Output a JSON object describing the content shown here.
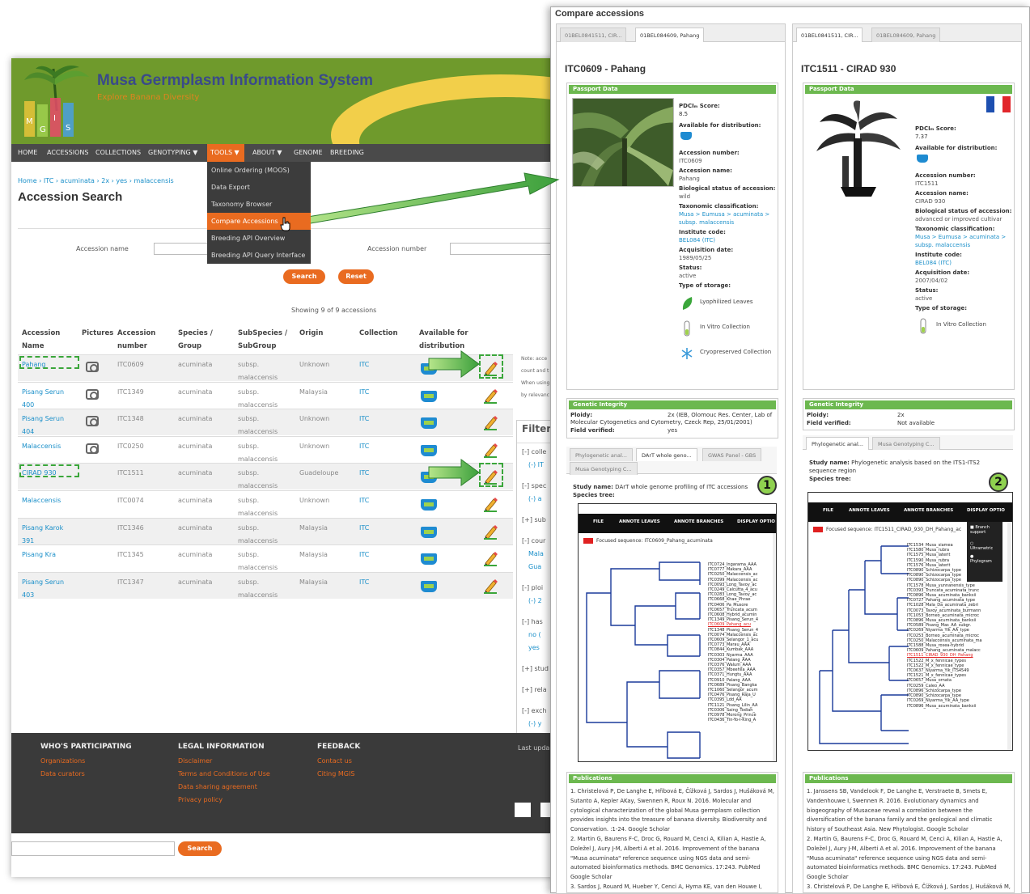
{
  "site": {
    "title": "Musa Germplasm Information System",
    "subtitle": "Explore Banana Diversity",
    "logo_letters": "MGIS"
  },
  "nav": {
    "items": [
      "HOME",
      "ACCESSIONS",
      "COLLECTIONS",
      "GENOTYPING ▼",
      "TOOLS ▼",
      "ABOUT ▼",
      "GENOME",
      "BREEDING"
    ],
    "active": "TOOLS ▼"
  },
  "tools_menu": {
    "items": [
      "Online Ordering (MOOS)",
      "Data Export",
      "Taxonomy Browser",
      "Compare Accessions",
      "Breeding API Overview",
      "Breeding API Query Interface"
    ],
    "highlighted": "Compare Accessions"
  },
  "breadcrumb": "Home › ITC › acuminata › 2x › yes › malaccensis",
  "page_title": "Accession Search",
  "search": {
    "accession_name_label": "Accession name",
    "accession_number_label": "Accession number",
    "search_button": "Search",
    "reset_button": "Reset"
  },
  "results": {
    "showing": "Showing 9 of 9 accessions",
    "headers": {
      "name": [
        "Accession",
        "Name"
      ],
      "pictures": "Pictures",
      "number": [
        "Accession",
        "number"
      ],
      "species": [
        "Species /",
        "Group"
      ],
      "subspecies": [
        "SubSpecies /",
        "SubGroup"
      ],
      "origin": "Origin",
      "collection": "Collection",
      "available": [
        "Available for",
        "distribution"
      ]
    },
    "rows": [
      {
        "name": [
          "Pahang"
        ],
        "pic": true,
        "number": "ITC0609",
        "species": "acuminata",
        "sub": [
          "subsp.",
          "malaccensis"
        ],
        "origin": "Unknown",
        "collection": "ITC"
      },
      {
        "name": [
          "Pisang Serun",
          "400"
        ],
        "pic": true,
        "number": "ITC1349",
        "species": "acuminata",
        "sub": [
          "subsp.",
          "malaccensis"
        ],
        "origin": "Malaysia",
        "collection": "ITC"
      },
      {
        "name": [
          "Pisang Serun",
          "404"
        ],
        "pic": true,
        "number": "ITC1348",
        "species": "acuminata",
        "sub": [
          "subsp.",
          "malaccensis"
        ],
        "origin": "Unknown",
        "collection": "ITC"
      },
      {
        "name": [
          "Malaccensis"
        ],
        "pic": true,
        "number": "ITC0250",
        "species": "acuminata",
        "sub": [
          "subsp.",
          "malaccensis"
        ],
        "origin": "Unknown",
        "collection": "ITC"
      },
      {
        "name": [
          "CIRAD 930"
        ],
        "pic": false,
        "number": "ITC1511",
        "species": "acuminata",
        "sub": [
          "subsp.",
          "malaccensis"
        ],
        "origin": "Guadeloupe",
        "collection": "ITC"
      },
      {
        "name": [
          "Malaccensis"
        ],
        "pic": false,
        "number": "ITC0074",
        "species": "acuminata",
        "sub": [
          "subsp.",
          "malaccensis"
        ],
        "origin": "Unknown",
        "collection": "ITC"
      },
      {
        "name": [
          "Pisang Karok",
          "391"
        ],
        "pic": false,
        "number": "ITC1346",
        "species": "acuminata",
        "sub": [
          "subsp.",
          "malaccensis"
        ],
        "origin": "Malaysia",
        "collection": "ITC"
      },
      {
        "name": [
          "Pisang Kra"
        ],
        "pic": false,
        "number": "ITC1345",
        "species": "acuminata",
        "sub": [
          "subsp.",
          "malaccensis"
        ],
        "origin": "Malaysia",
        "collection": "ITC"
      },
      {
        "name": [
          "Pisang Serun",
          "403"
        ],
        "pic": false,
        "number": "ITC1347",
        "species": "acuminata",
        "sub": [
          "subsp.",
          "malaccensis"
        ],
        "origin": "Malaysia",
        "collection": "ITC"
      }
    ]
  },
  "side_note": [
    "Note: acce",
    "count and t",
    "When using",
    "by relevanc"
  ],
  "filter": {
    "title": "Filter",
    "groups": [
      {
        "h": "[-] colle",
        "items": [
          "(-) IT"
        ]
      },
      {
        "h": "[-] spec",
        "items": [
          "(-) a"
        ]
      },
      {
        "h": "[+] sub",
        "items": []
      },
      {
        "h": "[-] cour",
        "items": [
          "Mala",
          "Gua"
        ]
      },
      {
        "h": "[-] ploi",
        "items": [
          "(-) 2"
        ]
      },
      {
        "h": "[-] has",
        "items": [
          "no (",
          "yes"
        ]
      },
      {
        "h": "[+] stud",
        "items": []
      },
      {
        "h": "[+] rela",
        "items": []
      },
      {
        "h": "[-] exch",
        "items": [
          "(-) y"
        ]
      }
    ]
  },
  "footer": {
    "cols": [
      {
        "h": "WHO'S PARTICIPATING",
        "links": [
          "Organizations",
          "Data curators"
        ]
      },
      {
        "h": "LEGAL INFORMATION",
        "links": [
          "Disclaimer",
          "Terms and Conditions of Use",
          "Data sharing agreement",
          "Privacy policy"
        ]
      },
      {
        "h": "FEEDBACK",
        "links": [
          "Contact us",
          "Citing MGIS"
        ]
      }
    ],
    "last_update": "Last upda"
  },
  "bottom_search_button": "Search",
  "compare": {
    "title": "Compare accessions",
    "tabs": [
      "01BEL0841511, CIR...",
      "01BEL084609, Pahang"
    ],
    "left": {
      "heading": "ITC0609 - Pahang",
      "active_tab": 1,
      "passport_title": "Passport Data",
      "pdci_label": "PDCIₘ Score:",
      "pdci": "8.5",
      "avail_label": "Available for distribution:",
      "fields": [
        [
          "Accession number:",
          "ITC0609"
        ],
        [
          "Accession name:",
          "Pahang"
        ],
        [
          "Biological status of accession:",
          "wild"
        ],
        [
          "Taxonomic classification:",
          "Musa > Eumusa > acuminata >",
          "subsp. malaccensis"
        ],
        [
          "Institute code:",
          "BEL084 (ITC)"
        ],
        [
          "Acquisition date:",
          "1989/05/25"
        ],
        [
          "Status:",
          "active"
        ],
        [
          "Type of storage:",
          ""
        ]
      ],
      "storage": [
        "Lyophilized Leaves",
        "In Vitro Collection",
        "Cryopreserved Collection"
      ],
      "genetic_title": "Genetic Integrity",
      "ploidy_label": "Ploidy:",
      "ploidy": "2x   (IEB, Olomouc Res. Center, Lab of",
      "ploidy2": "Molecular Cytogenetics and Cytometry, Czeck Rep, 25/01/2001)",
      "field_verified_label": "Field verified:",
      "field_verified": "yes",
      "subtabs": [
        "Phylogenetic anal...",
        "DArT whole geno...",
        "GWAS Panel - GBS",
        "Musa Genotyping C..."
      ],
      "study_label": "Study name:",
      "study": "DArT whole genome profiling of ITC accessions",
      "species_tree": "Species tree:",
      "tree_buttons": [
        "FILE",
        "ANNOTE LEAVES",
        "ANNOTE BRANCHES",
        "DISPLAY OPTIO"
      ],
      "focused": "Focused sequence: ITC0609_Pahang_acuminata",
      "badge": "1",
      "pub_title": "Publications",
      "pubs": "1. Christelová P, De Langhe E, Hřibová E, Čížková J, Sardos J, Hušáková M, Sutanto A, Kepler AKay, Swennen R, Roux N.  2016.  Molecular and cytological characterization of the global Musa germplasm collection provides insights into the treasure of banana diversity. Biodiversity and Conservation. :1-24. Google Scholar\n2. Martin G, Baurens F-C, Droc G, Rouard M, Cenci A, Kilian A, Hastie A, Doležel J, Aury J-M, Alberti A et al.  2016.  Improvement of the banana \"Musa acuminata\" reference sequence using NGS data and semi-automated bioinformatics methods. BMC Genomics. 17:243. PubMed  Google Scholar\n3. Sardos J, Rouard M, Hueber Y, Cenci A, Hyma KE, van den Houwe I, Hribova E, Courtois B, Roux N.  2016.  A Genome-Wide Association"
    },
    "right": {
      "heading": "ITC1511 - CIRAD 930",
      "active_tab": 0,
      "passport_title": "Passport Data",
      "pdci_label": "PDCIₘ Score:",
      "pdci": "7.37",
      "avail_label": "Available for distribution:",
      "fields": [
        [
          "Accession number:",
          "ITC1511"
        ],
        [
          "Accession name:",
          "CIRAD 930"
        ],
        [
          "Biological status of accession:",
          "advanced or improved cultivar"
        ],
        [
          "Taxonomic classification:",
          "Musa > Eumusa > acuminata >",
          "subsp. malaccensis"
        ],
        [
          "Institute code:",
          "BEL084 (ITC)"
        ],
        [
          "Acquisition date:",
          "2007/04/02"
        ],
        [
          "Status:",
          "active"
        ],
        [
          "Type of storage:",
          ""
        ]
      ],
      "storage": [
        "In Vitro Collection"
      ],
      "genetic_title": "Genetic Integrity",
      "ploidy_label": "Ploidy:",
      "ploidy": "2x",
      "field_verified_label": "Field verified:",
      "field_verified": "Not available",
      "subtabs": [
        "Phylogenetic anal...",
        "Musa Genotyping C..."
      ],
      "study_label": "Study name:",
      "study": "Phylogenetic analysis based on the ITS1-ITS2",
      "study2": "sequence region",
      "species_tree": "Species tree:",
      "tree_buttons": [
        "FILE",
        "ANNOTE LEAVES",
        "ANNOTE BRANCHES",
        "DISPLAY OPTIO"
      ],
      "focused": "Focused sequence: ITC1511_CIRAD_930_DH_Pahang_ac",
      "display_opts": [
        "Branch support",
        "Ultrametric",
        "Phylogram"
      ],
      "badge": "2",
      "pub_title": "Publications",
      "pubs": "1. Janssens SB, Vandelook F, De Langhe E, Verstraete B, Smets E, Vandenhouwe I, Swennen R.  2016.  Evolutionary dynamics and biogeography of Musaceae reveal a correlation between the diversification of the banana family and the geological and climatic history of Southeast Asia. New Phytologist.  Google Scholar\n2. Martin G, Baurens F-C, Droc G, Rouard M, Cenci A, Kilian A, Hastie A, Doležel J, Aury J-M, Alberti A et al.  2016.  Improvement of the banana \"Musa acuminata\" reference sequence using NGS data and semi-automated bioinformatics methods. BMC Genomics. 17:243. PubMed  Google Scholar\n3. Christelová P, De Langhe E, Hřibová E, Čížková J, Sardos J, Hušáková M, Sutanto A, Kepler AKay, Swennen R, Roux N.  2016.  Molecular and"
    },
    "tree_left_leaves": "ITC0724_Ingarama_AAA\nITC0777_Makara_AAA\nITC0250_Malaccensis_ac\nITC0399_Malaccensis_ac\nITC0093_Long_Tavoy_ac\nITC0249_Calcutta_4_acu\nITC0283_Long_Tavoy_ac\nITC0668_Khae_Phrae\nITC0406_Pa_Musore\nITC0657_Truncata_acum\nITC0608_Hybrid_acumin\nITC1349_Pisang_Serun_4\nITC0609_Pahang_acu\nITC1348_Pisang_Serun_4\nITC0074_Malaccensis_ac\nITC0609_Selangor_1_acu\nITC0773_Marau_AAA\nITC0844_Kumbak_AAA\nITC0303_Nyarma_AAA\nITC0304_Palang_AAA\nITC0376_Walum_AAA\nITC0357_Mbeehila_AAA\nITC0371_Hungtu_AAA\nITC0910_Palang_AAA\nITC0689_Pisang_Bangka\nITC1060_Selangor_acum\nITC0476_Pisang_Raja_U\nITC0395_Ldd_AA\nITC1121_Pisang_Lilin_AA\nITC0306_Saing_Todiah_\nITC0978_Morong_Prince\nITC0436_Tin-Yo-I-King_A",
    "tree_right_leaves": "ITC1534_Musa_siamea\nITC1580_Musa_rubra\nITC1575_Musa_laterit\nITC1590_Musa_rubra\nITC1576_Musa_laterit\nITC0890_Schizocarpa_type\nITC0890_Schizocarpa_type\nITC0890_Schizocarpa_type\nITC1578_Musa_yunnanensis_type\nITC0393_Truncata_acuminata_trunc\nITC0896_Musa_acuminata_banksii\nITC0727_Pahang_acuminata_type\nITC1028_Mala_Da_acuminata_zebri\nITC0073_Tavoy_acuminata_burmann\nITC1053_Borneo_acuminata_microc\nITC0896_Musa_acuminata_banksii\nITC0589_Pisang_Mas_AA_subgr.\nITC0269_Niyarma_Yik_AA_type\nITC0253_Borneo_acuminata_microc\nITC0250_Malaccensis_acuminata_ma\nITC1588_Musa_rosea-hybrid\nITC0609_Pahang_acuminata_malacc\nITC1511_CIRAD_930_DH_Pahang\nITC1522_M_x_fennicae_types\nITC1522_M_x_fennicae_type\nITC0637_Niyarma_Yik_ITS4549\nITC1521_M_x_fennicae_types\nITC0657_Musa_ornata\nITC0259_Caleo_AA\nITC0896_Schizocarpa_type\nITC0890_Schizocarpa_type\nITC0269_Niyarma_Yik_AA_type\nITC0896_Musa_acuminata_banksii"
  }
}
